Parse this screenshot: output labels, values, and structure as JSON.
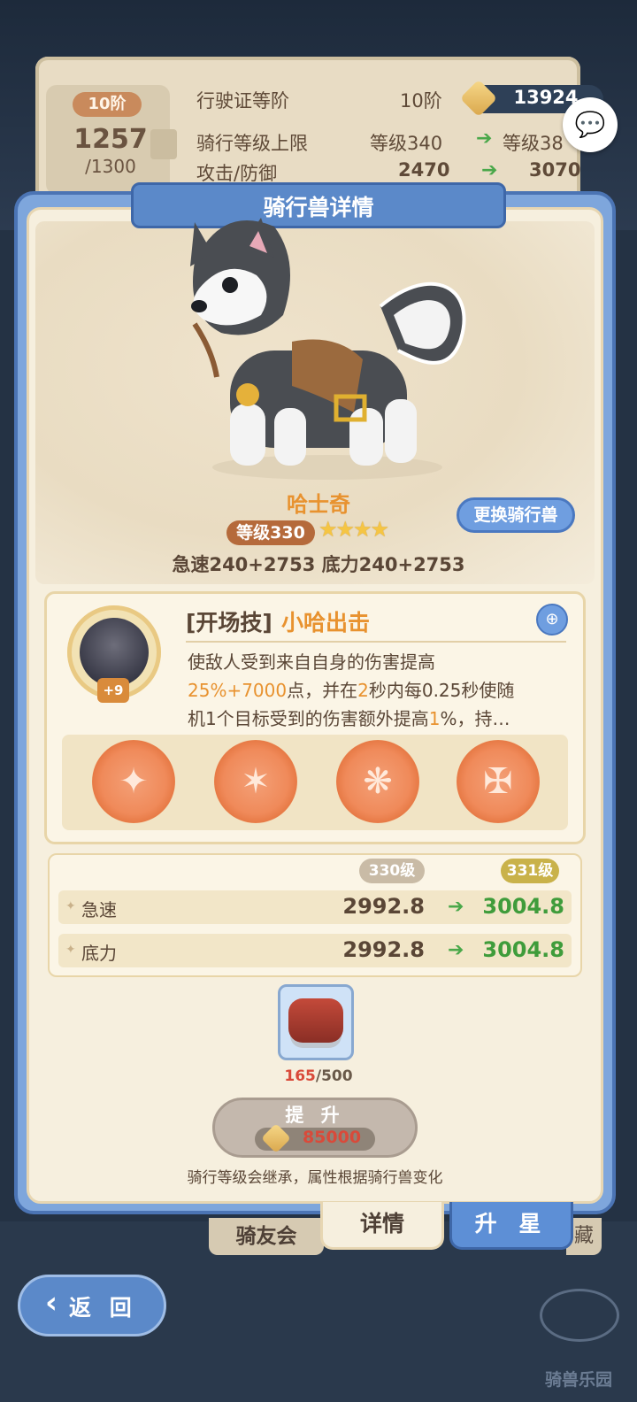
{
  "background": {
    "rank": {
      "badge": "10阶",
      "current": "1257",
      "max": "/1300"
    },
    "rows": [
      {
        "label": "行驶证等阶",
        "value": "10阶",
        "next": ""
      },
      {
        "label": "骑行等级上限",
        "value": "等级340",
        "next": "等级38"
      },
      {
        "label": "攻击/防御",
        "value": "2470",
        "next": "3070"
      }
    ],
    "currency": "13924",
    "colors": {
      "coin": "#e0b558"
    }
  },
  "dialog": {
    "title": "骑行兽详情",
    "pet": {
      "name": "哈士奇",
      "level": "等级330",
      "stars": "★★★★",
      "stats": "急速240+2753  底力240+2753",
      "change_button": "更换骑行兽"
    },
    "skill": {
      "tag": "[开场技]",
      "name": "小哈出击",
      "badge": "+9",
      "line1": "使敌人受到来自自身的伤害提高",
      "l2_a": "25%+7000",
      "l2_b": "点，并在",
      "l2_c": "2",
      "l2_d": "秒内每0.25秒使随",
      "l3_a": "机1个目标受到的伤害额外提高",
      "l3_b": "1",
      "l3_c": "%，持…"
    },
    "upgrade_table": {
      "current_level": "330级",
      "next_level": "331级",
      "rows": [
        {
          "name": "急速",
          "current": "2992.8",
          "next": "3004.8"
        },
        {
          "name": "底力",
          "current": "2992.8",
          "next": "3004.8"
        }
      ]
    },
    "material": {
      "have": "165",
      "need": "/500"
    },
    "upgrade_button": {
      "label": "提 升",
      "cost": "85000"
    },
    "note": "骑行等级会继承，属性根据骑行兽变化"
  },
  "tabs": {
    "club": "骑友会",
    "detail": "详情",
    "star": "升 星",
    "hidden": "藏"
  },
  "back_button": "返 回",
  "logo_text": "骑兽乐园"
}
